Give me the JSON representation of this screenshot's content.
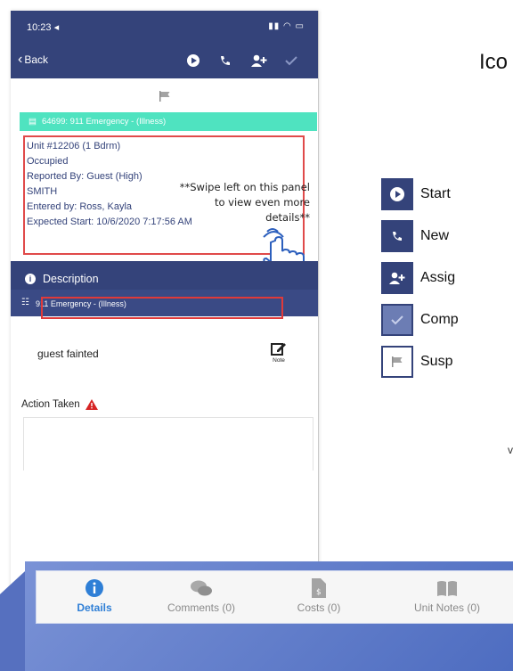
{
  "status": {
    "time": "10:23 ◂"
  },
  "nav": {
    "back_label": "Back"
  },
  "work_order": {
    "title": "64699: 911 Emergency - (Illness)",
    "details": [
      "Unit #12206 (1 Bdrm)",
      "Occupied",
      "Reported By: Guest  (High)",
      "SMITH",
      "Entered by: Ross, Kayla",
      "Expected Start: 10/6/2020 7:17:56 AM"
    ]
  },
  "annotation": {
    "swipe_hint": "**Swipe left on this panel to view even more details**"
  },
  "description": {
    "header": "Description",
    "problem_type": "911 Emergency - (Illness)",
    "text": "guest fainted",
    "note_label": "Note"
  },
  "action": {
    "label": "Action Taken"
  },
  "legend": {
    "title": "Ico",
    "items": [
      "Start",
      "New",
      "Assig",
      "Comp",
      "Susp"
    ],
    "trailing": "v"
  },
  "tabs": [
    "Details",
    "Comments (0)",
    "Costs (0)",
    "Unit Notes (0)"
  ],
  "colors": {
    "navy": "#34437a",
    "teal": "#4fe3c0",
    "active_tab": "#2f7fd6",
    "highlight_red": "#e03a3a"
  }
}
